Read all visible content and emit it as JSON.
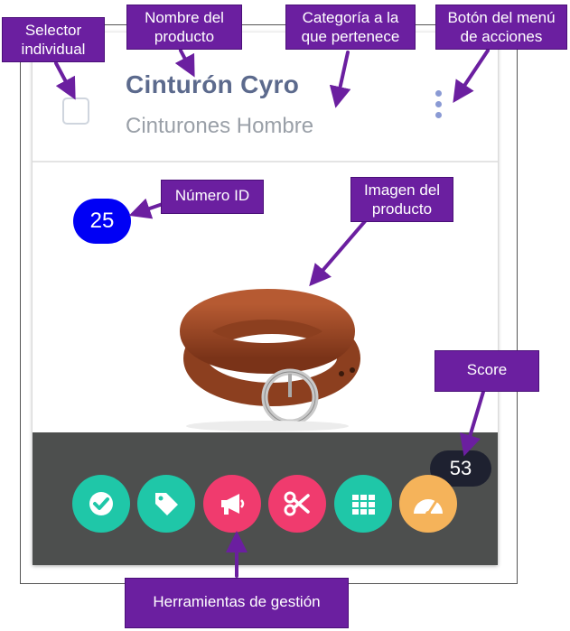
{
  "card": {
    "product_name": "Cinturón Cyro",
    "category": "Cinturones Hombre",
    "id_number": "25",
    "score": "53"
  },
  "tools": [
    {
      "icon": "check-circle-icon",
      "color": "#1fc7a8"
    },
    {
      "icon": "tag-icon",
      "color": "#1fc7a8"
    },
    {
      "icon": "megaphone-icon",
      "color": "#f03b6e"
    },
    {
      "icon": "scissors-icon",
      "color": "#f03b6e"
    },
    {
      "icon": "grid-icon",
      "color": "#1fc7a8"
    },
    {
      "icon": "speedometer-icon",
      "color": "#f5b35a"
    }
  ],
  "callouts": {
    "selector": "Selector individual",
    "name": "Nombre del producto",
    "category": "Categoría a la que pertenece",
    "menu": "Botón del menú de acciones",
    "id": "Número ID",
    "image": "Imagen del producto",
    "score": "Score",
    "tools": "Herramientas de gestión"
  },
  "colors": {
    "callout_bg": "#6b1fa0",
    "id_badge": "#0000f5",
    "toolbar_bg": "#4d4f4e",
    "score_badge": "#1e2130"
  }
}
